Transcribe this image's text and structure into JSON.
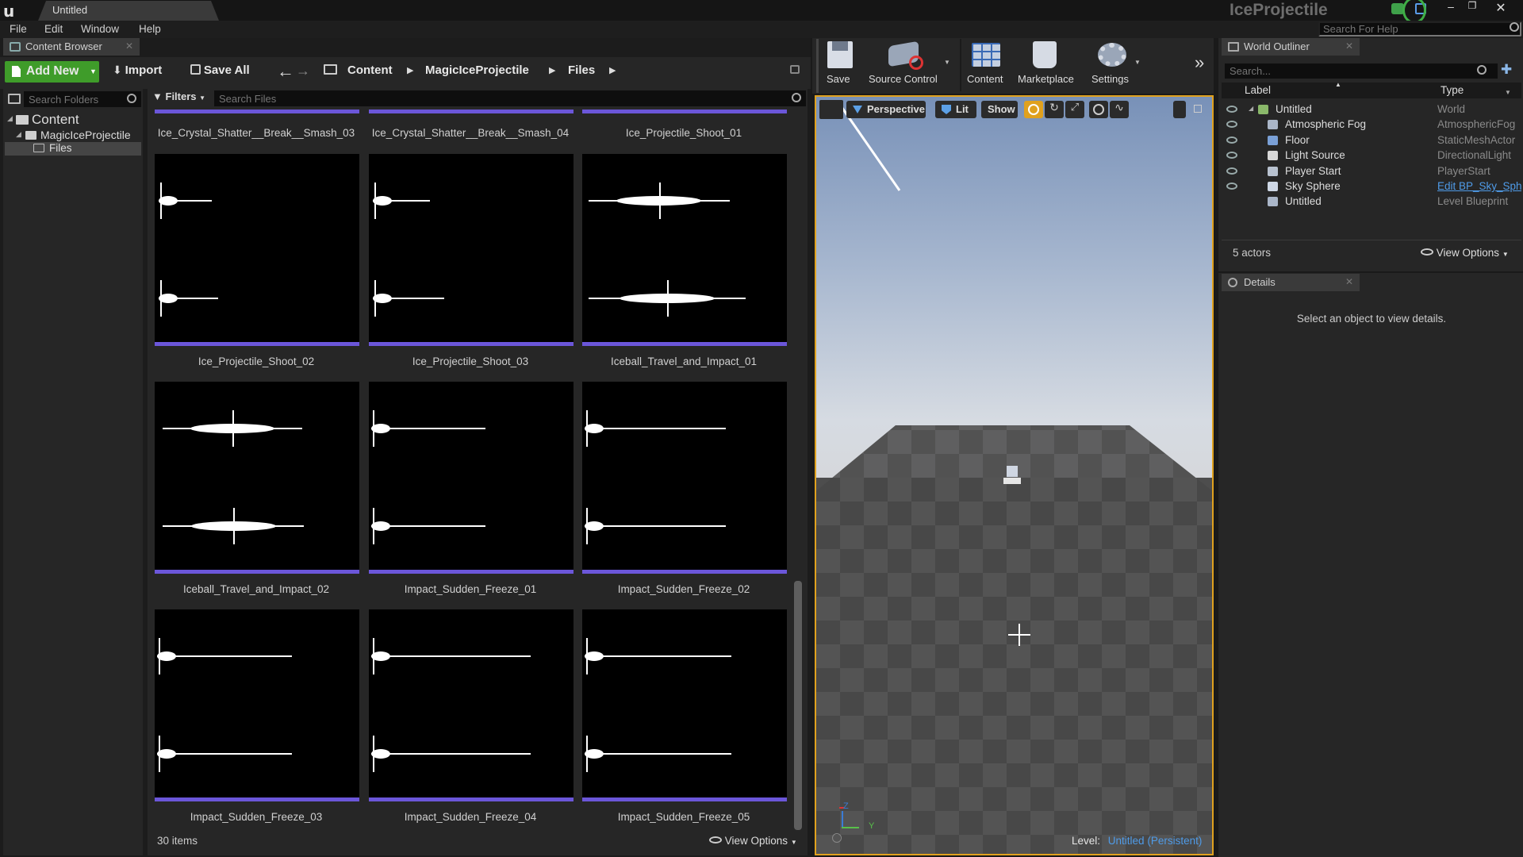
{
  "window": {
    "doc_tab": "Untitled",
    "project_name": "IceProjectile",
    "help_search_placeholder": "Search For Help"
  },
  "menu": [
    "File",
    "Edit",
    "Window",
    "Help"
  ],
  "content_browser": {
    "tab_label": "Content Browser",
    "add_new": "Add New",
    "import": "Import",
    "save_all": "Save All",
    "breadcrumb": [
      "Content",
      "MagicIceProjectile",
      "Files"
    ],
    "search_folders_placeholder": "Search Folders",
    "filters": "Filters",
    "search_files_placeholder": "Search Files",
    "tree": {
      "root": "Content",
      "child": "MagicIceProjectile",
      "grandchild": "Files"
    },
    "top_labels": [
      "Ice_Crystal_Shatter__Break__Smash_03",
      "Ice_Crystal_Shatter__Break__Smash_04",
      "Ice_Projectile_Shoot_01"
    ],
    "assets": [
      {
        "name": "Ice_Projectile_Shoot_02"
      },
      {
        "name": "Ice_Projectile_Shoot_03"
      },
      {
        "name": "Iceball_Travel_and_Impact_01"
      },
      {
        "name": "Iceball_Travel_and_Impact_02"
      },
      {
        "name": "Impact_Sudden_Freeze_01"
      },
      {
        "name": "Impact_Sudden_Freeze_02"
      },
      {
        "name": "Impact_Sudden_Freeze_03"
      },
      {
        "name": "Impact_Sudden_Freeze_04"
      },
      {
        "name": "Impact_Sudden_Freeze_05"
      }
    ],
    "item_count": "30 items",
    "view_options": "View Options"
  },
  "toolbar": {
    "save": "Save",
    "source_control": "Source Control",
    "content": "Content",
    "marketplace": "Marketplace",
    "settings": "Settings"
  },
  "viewport": {
    "perspective": "Perspective",
    "lit": "Lit",
    "show": "Show",
    "level_label": "Level:",
    "level_value": "Untitled (Persistent)",
    "axis_z": "Z",
    "axis_y": "Y"
  },
  "world_outliner": {
    "tab_label": "World Outliner",
    "search_placeholder": "Search...",
    "col_label": "Label",
    "col_type": "Type",
    "rows": [
      {
        "label": "Untitled",
        "type": "World"
      },
      {
        "label": "Atmospheric Fog",
        "type": "AtmosphericFog"
      },
      {
        "label": "Floor",
        "type": "StaticMeshActor"
      },
      {
        "label": "Light Source",
        "type": "DirectionalLight"
      },
      {
        "label": "Player Start",
        "type": "PlayerStart"
      },
      {
        "label": "Sky Sphere",
        "type": "Edit BP_Sky_Sphere"
      },
      {
        "label": "Untitled",
        "type": "Level Blueprint"
      }
    ],
    "actor_count": "5 actors",
    "view_options": "View Options"
  },
  "details": {
    "tab_label": "Details",
    "empty_message": "Select an object to view details."
  },
  "colors": {
    "accent_green": "#3f9c2a",
    "asset_bar": "#6b56d9",
    "viewport_border": "#e0a11e",
    "link_blue": "#4f9be8"
  }
}
